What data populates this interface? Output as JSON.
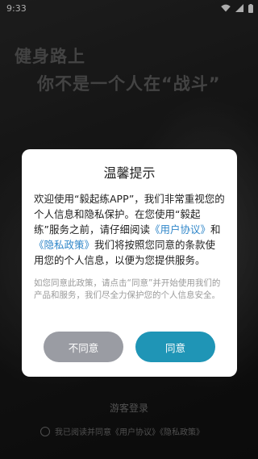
{
  "status_bar": {
    "time": "9:33"
  },
  "background": {
    "slogan_line1": "健身路上",
    "slogan_line2": "你不是一个人在“战斗”"
  },
  "footer": {
    "guest_login": "游客登录",
    "agree_text": "我已阅读并同意《用户协议》《隐私政策》"
  },
  "dialog": {
    "title": "温馨提示",
    "body_part1": "欢迎使用“毅起练APP”，我们非常重视您的个人信息和隐私保护。在您使用“毅起练”服务之前，请仔细阅读",
    "user_agreement_link": "《用户协议》",
    "and": "和",
    "privacy_policy_link": "《隐私政策》",
    "body_part2": "我们将按照您同意的条款使用您的个人信息，以便为您提供服务。",
    "note": "如您同意此政策，请点击“同意”并开始使用我们的产品和服务，我们尽全力保护您的个人信息安全。",
    "disagree_label": "不同意",
    "agree_label": "同意"
  },
  "colors": {
    "agree_button": "#1f95b6",
    "disagree_button": "#9a9ca3",
    "link": "#2f86c9"
  }
}
